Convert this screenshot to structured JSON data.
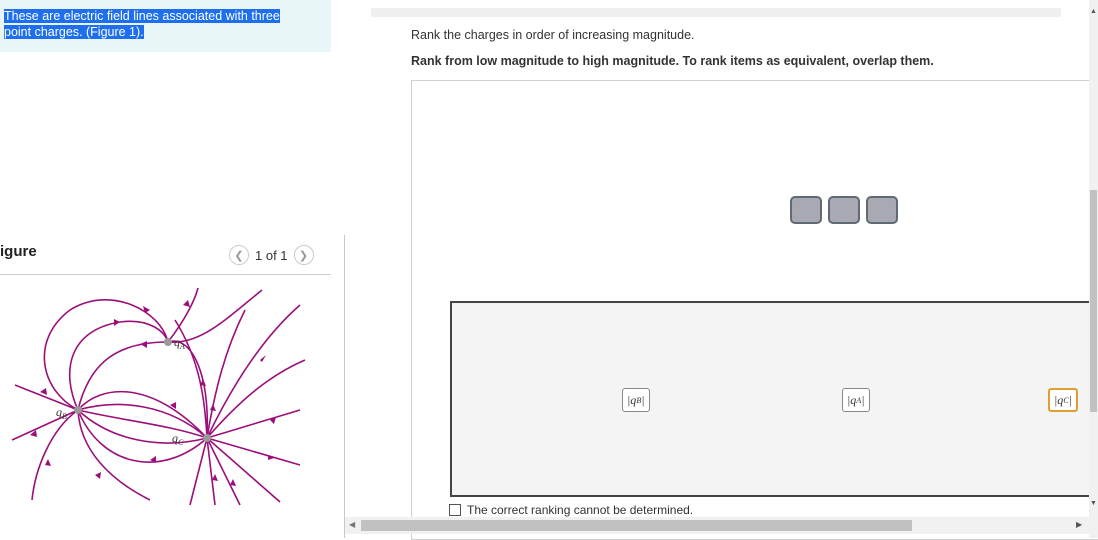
{
  "intro": {
    "line1": "These are electric field lines associated with three",
    "line2": "point charges. (Figure 1)."
  },
  "figure": {
    "label": "igure",
    "pager_text": "1 of 1",
    "prev_icon": "chevron-left-icon",
    "next_icon": "chevron-right-icon",
    "charge_labels": {
      "a": "q",
      "a_sub": "A",
      "b": "q",
      "b_sub": "B",
      "c": "q",
      "c_sub": "C"
    },
    "line_color": "#9b0f7a"
  },
  "question": {
    "prompt": "Rank the charges in order of increasing magnitude.",
    "instruction": "Rank from low magnitude to high magnitude. To rank items as equivalent, overlap them."
  },
  "ranking": {
    "slot_count": 3,
    "items": [
      {
        "label": "|q",
        "sub": "B",
        "end": "|"
      },
      {
        "label": "|q",
        "sub": "A",
        "end": "|"
      },
      {
        "label": "|q",
        "sub": "C",
        "end": "|"
      }
    ],
    "cannot_determine_label": "The correct ranking cannot be determined."
  }
}
